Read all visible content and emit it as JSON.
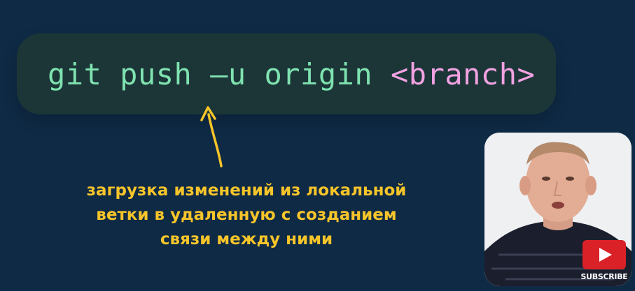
{
  "command": {
    "keyword": "git",
    "verb": "push",
    "flag": "–u",
    "remote": "origin",
    "argument": "<branch>"
  },
  "annotation": {
    "lines": [
      "загрузка изменений из локальной",
      "ветки в удаленную с созданием",
      "связи между ними"
    ]
  },
  "subscribe": {
    "label": "SUBSCRIBE"
  },
  "colors": {
    "background": "#0f2a45",
    "code_box": "#1c3638",
    "command_text": "#7fe3b0",
    "argument_text": "#f2a2e2",
    "annotation": "#f7c52a",
    "subscribe_red": "#d92127"
  }
}
